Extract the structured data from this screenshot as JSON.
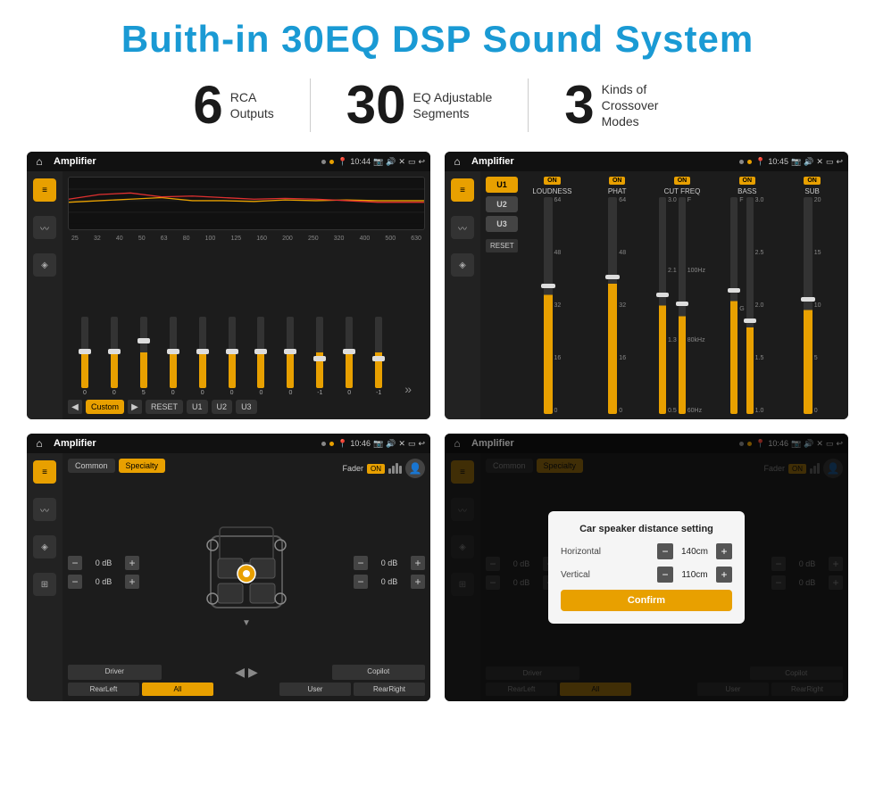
{
  "page": {
    "title": "Buith-in 30EQ DSP Sound System",
    "stats": [
      {
        "number": "6",
        "label": "RCA\nOutputs"
      },
      {
        "number": "30",
        "label": "EQ Adjustable\nSegments"
      },
      {
        "number": "3",
        "label": "Kinds of\nCrossover Modes"
      }
    ]
  },
  "screens": {
    "eq": {
      "statusBar": {
        "appName": "Amplifier",
        "time": "10:44"
      },
      "freqLabels": [
        "25",
        "32",
        "40",
        "50",
        "63",
        "80",
        "100",
        "125",
        "160",
        "200",
        "250",
        "320",
        "400",
        "500",
        "630"
      ],
      "sliderValues": [
        "0",
        "0",
        "0",
        "5",
        "0",
        "0",
        "0",
        "0",
        "0",
        "-1",
        "0",
        "-1"
      ],
      "bottomBtns": [
        "Custom",
        "RESET",
        "U1",
        "U2",
        "U3"
      ]
    },
    "crossover": {
      "statusBar": {
        "appName": "Amplifier",
        "time": "10:45"
      },
      "uButtons": [
        "U1",
        "U2",
        "U3"
      ],
      "channels": [
        {
          "name": "LOUDNESS",
          "on": true
        },
        {
          "name": "PHAT",
          "on": true
        },
        {
          "name": "CUT FREQ",
          "on": true
        },
        {
          "name": "BASS",
          "on": true
        },
        {
          "name": "SUB",
          "on": true
        }
      ],
      "resetLabel": "RESET"
    },
    "speaker1": {
      "statusBar": {
        "appName": "Amplifier",
        "time": "10:46"
      },
      "tabs": [
        "Common",
        "Specialty"
      ],
      "faderLabel": "Fader",
      "faderOn": "ON",
      "leftControls": [
        "0 dB",
        "0 dB"
      ],
      "rightControls": [
        "0 dB",
        "0 dB"
      ],
      "bottomBtns": [
        "Driver",
        "",
        "",
        "",
        "",
        "Copilot",
        "RearLeft",
        "All",
        "",
        "User",
        "RearRight"
      ]
    },
    "speaker2": {
      "statusBar": {
        "appName": "Amplifier",
        "time": "10:46"
      },
      "tabs": [
        "Common",
        "Specialty"
      ],
      "dialog": {
        "title": "Car speaker distance setting",
        "horizontal": {
          "label": "Horizontal",
          "value": "140cm"
        },
        "vertical": {
          "label": "Vertical",
          "value": "110cm"
        },
        "confirmBtn": "Confirm"
      },
      "rightControls": [
        "0 dB",
        "0 dB"
      ],
      "bottomBtns": [
        "Driver",
        "",
        "",
        "",
        "",
        "Copilot",
        "RearLeft",
        "All",
        "",
        "User",
        "RearRight"
      ]
    }
  }
}
